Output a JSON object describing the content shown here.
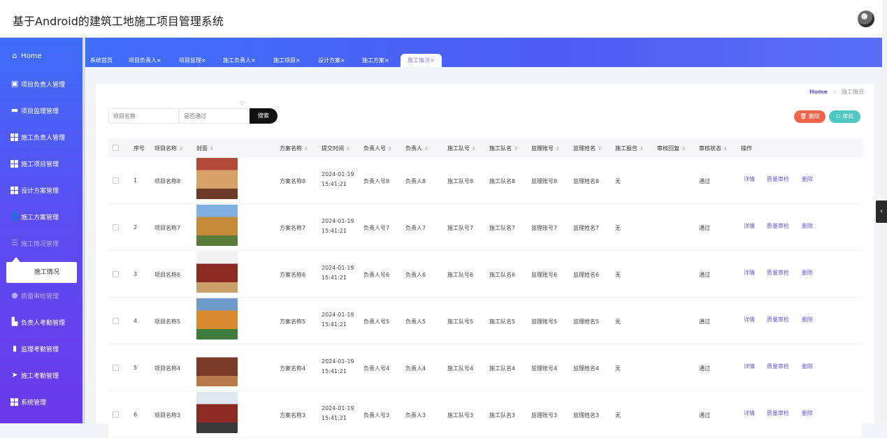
{
  "app": {
    "title": "基于Android的建筑工地施工项目管理系统"
  },
  "sidebar": {
    "items": [
      {
        "label": "Home",
        "icon": "home-icon"
      },
      {
        "label": "项目负责人管理",
        "icon": "clipboard-icon"
      },
      {
        "label": "项目监理管理",
        "icon": "briefcase-icon"
      },
      {
        "label": "施工负责人管理",
        "icon": "grid-icon"
      },
      {
        "label": "施工项目管理",
        "icon": "grid-icon"
      },
      {
        "label": "设计方案管理",
        "icon": "grid-icon"
      },
      {
        "label": "施工方案管理",
        "icon": "user-icon"
      },
      {
        "label": "施工情况管理",
        "icon": "list-icon"
      },
      {
        "label": "质量审检管理",
        "icon": "bulb-icon"
      },
      {
        "label": "负责人考勤管理",
        "icon": "chart-icon"
      },
      {
        "label": "监理考勤管理",
        "icon": "bar-chart-icon"
      },
      {
        "label": "施工考勤管理",
        "icon": "send-icon"
      },
      {
        "label": "系统管理",
        "icon": "grid-icon"
      }
    ],
    "submenu": {
      "label": "施工情况"
    }
  },
  "tabs": [
    "系统首页",
    "项目负责人×",
    "项目监理×",
    "施工负责人×",
    "施工项目×",
    "设计方案×",
    "施工方案×",
    "施工情况×"
  ],
  "breadcrumb": {
    "home": "Home",
    "sep": ">",
    "current": "施工情况"
  },
  "search": {
    "name_placeholder": "项目名称",
    "pass_placeholder": "是否通过",
    "button": "搜索"
  },
  "actions": {
    "delete": "删除",
    "audit": "审核"
  },
  "table": {
    "columns": [
      "序号",
      "项目名称",
      "封面",
      "方案名称",
      "提交时间",
      "负责人号",
      "负责人",
      "施工队号",
      "施工队名",
      "监理账号",
      "监理姓名",
      "施工报告",
      "审核回复",
      "审核状态",
      "操作"
    ],
    "row_actions": [
      "详情",
      "质量审检",
      "删除"
    ],
    "rows": [
      {
        "no": "1",
        "project": "项目名称8",
        "plan": "方案名称8",
        "date": "2024-01-19",
        "time": "15:41:21",
        "leader_no": "负责人号8",
        "leader": "负责人8",
        "team_no": "施工队号8",
        "team": "施工队名8",
        "sup_acc": "监理账号8",
        "sup_name": "监理姓名8",
        "report": "无",
        "reply": "",
        "status": "通过"
      },
      {
        "no": "2",
        "project": "项目名称7",
        "plan": "方案名称7",
        "date": "2024-01-19",
        "time": "15:41:21",
        "leader_no": "负责人号7",
        "leader": "负责人7",
        "team_no": "施工队号7",
        "team": "施工队名7",
        "sup_acc": "监理账号7",
        "sup_name": "监理姓名7",
        "report": "无",
        "reply": "",
        "status": "通过"
      },
      {
        "no": "3",
        "project": "项目名称6",
        "plan": "方案名称6",
        "date": "2024-01-19",
        "time": "15:41:21",
        "leader_no": "负责人号6",
        "leader": "负责人6",
        "team_no": "施工队号6",
        "team": "施工队名6",
        "sup_acc": "监理账号6",
        "sup_name": "监理姓名6",
        "report": "无",
        "reply": "",
        "status": "通过"
      },
      {
        "no": "4",
        "project": "项目名称5",
        "plan": "方案名称5",
        "date": "2024-01-19",
        "time": "15:41:21",
        "leader_no": "负责人号5",
        "leader": "负责人5",
        "team_no": "施工队号5",
        "team": "施工队名5",
        "sup_acc": "监理账号5",
        "sup_name": "监理姓名5",
        "report": "无",
        "reply": "",
        "status": "通过"
      },
      {
        "no": "5",
        "project": "项目名称4",
        "plan": "方案名称4",
        "date": "2024-01-19",
        "time": "15:41:21",
        "leader_no": "负责人号4",
        "leader": "负责人4",
        "team_no": "施工队号4",
        "team": "施工队名4",
        "sup_acc": "监理账号4",
        "sup_name": "监理姓名4",
        "report": "无",
        "reply": "",
        "status": "通过"
      },
      {
        "no": "6",
        "project": "项目名称3",
        "plan": "方案名称3",
        "date": "2024-01-19",
        "time": "15:41:21",
        "leader_no": "负责人号3",
        "leader": "负责人3",
        "team_no": "施工队号3",
        "team": "施工队名3",
        "sup_acc": "监理账号3",
        "sup_name": "监理姓名3",
        "report": "无",
        "reply": "",
        "status": "通过"
      }
    ]
  },
  "colors": {
    "accent": "#6b55d8",
    "sidebar_top": "#3f6ef8",
    "sidebar_bottom": "#6b39ea",
    "delete": "#f0654a",
    "audit": "#4fc7c3"
  }
}
